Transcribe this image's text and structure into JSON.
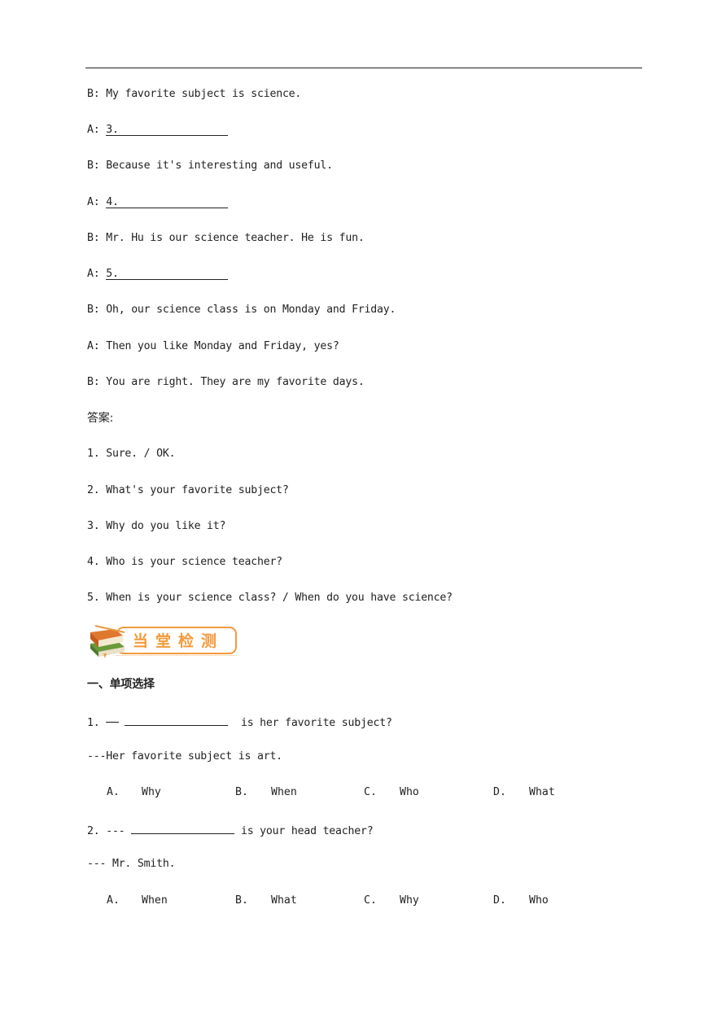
{
  "dialogue": [
    {
      "speaker": "B:",
      "text": "My favorite subject is science."
    },
    {
      "speaker": "A:",
      "blank_number": "3."
    },
    {
      "speaker": "B:",
      "text": "Because it's interesting and useful."
    },
    {
      "speaker": "A:",
      "blank_number": "4."
    },
    {
      "speaker": "B:",
      "text": "Mr. Hu is our science teacher. He is fun."
    },
    {
      "speaker": "A:",
      "blank_number": "5."
    },
    {
      "speaker": "B:",
      "text": "Oh, our science class is on Monday and Friday."
    },
    {
      "speaker": "A:",
      "text": "Then you like Monday and Friday, yes?"
    },
    {
      "speaker": "B:",
      "text": "You are right. They are my favorite days."
    }
  ],
  "answers": {
    "label": "答案:",
    "items": [
      "1. Sure. / OK.",
      "2. What's your favorite subject?",
      "3. Why do you like it?",
      "4. Who is your science teacher?",
      "5. When is your science class? / When do you have science?"
    ]
  },
  "banner": {
    "title": "当堂检测",
    "icon": "books-icon"
  },
  "section": {
    "title": "一、单项选择"
  },
  "questions": [
    {
      "number": "1.",
      "prefix": "──",
      "stem": "is her favorite subject?",
      "reply": "---Her favorite subject is art.",
      "options": [
        {
          "letter": "A.",
          "text": "Why"
        },
        {
          "letter": "B.",
          "text": "When"
        },
        {
          "letter": "C.",
          "text": "Who"
        },
        {
          "letter": "D.",
          "text": "What"
        }
      ]
    },
    {
      "number": "2.",
      "prefix": "---",
      "stem": "is your head teacher?",
      "reply": "--- Mr. Smith.",
      "options": [
        {
          "letter": "A.",
          "text": "When"
        },
        {
          "letter": "B.",
          "text": "What"
        },
        {
          "letter": "C.",
          "text": "Why"
        },
        {
          "letter": "D.",
          "text": "Who"
        }
      ]
    }
  ]
}
